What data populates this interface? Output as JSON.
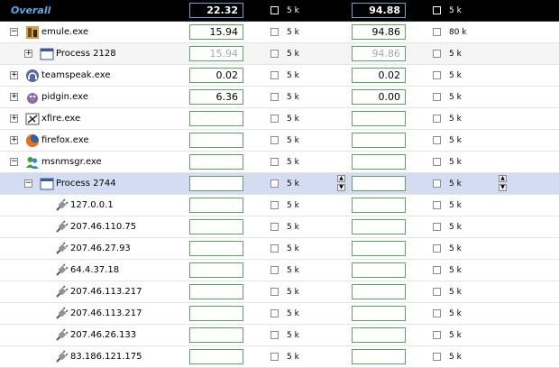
{
  "rows": [
    {
      "id": "overall",
      "label": "Overall",
      "down": "22.32",
      "down_limit": "5 k",
      "up": "94.88",
      "up_limit": "5 k"
    },
    {
      "id": "emule",
      "label": "emule.exe",
      "down": "15.94",
      "down_limit": "5 k",
      "up": "94.86",
      "up_limit": "80 k",
      "expander": "−",
      "icon": "emule-icon"
    },
    {
      "id": "process2128",
      "label": "Process 2128",
      "down": "15.94",
      "down_limit": "5 k",
      "up": "94.86",
      "up_limit": "5 k",
      "expander": "+",
      "icon": "window-icon"
    },
    {
      "id": "teamspeak",
      "label": "teamspeak.exe",
      "down": "0.02",
      "down_limit": "5 k",
      "up": "0.02",
      "up_limit": "5 k",
      "expander": "+",
      "icon": "headset-icon"
    },
    {
      "id": "pidgin",
      "label": "pidgin.exe",
      "down": "6.36",
      "down_limit": "5 k",
      "up": "0.00",
      "up_limit": "5 k",
      "expander": "+",
      "icon": "pidgin-icon"
    },
    {
      "id": "xfire",
      "label": "xfire.exe",
      "down": "",
      "down_limit": "5 k",
      "up": "",
      "up_limit": "5 k",
      "expander": "+",
      "icon": "xfire-icon"
    },
    {
      "id": "firefox",
      "label": "firefox.exe",
      "down": "",
      "down_limit": "5 k",
      "up": "",
      "up_limit": "5 k",
      "expander": "+",
      "icon": "firefox-icon"
    },
    {
      "id": "msnmsgr",
      "label": "msnmsgr.exe",
      "down": "",
      "down_limit": "5 k",
      "up": "",
      "up_limit": "5 k",
      "expander": "−",
      "icon": "msn-icon"
    },
    {
      "id": "process2744",
      "label": "Process 2744",
      "down": "",
      "down_limit": "5 k",
      "up": "",
      "up_limit": "5 k",
      "expander": "−",
      "icon": "window-icon"
    },
    {
      "id": "conn1",
      "label": "127.0.0.1",
      "down": "",
      "down_limit": "5 k",
      "up": "",
      "up_limit": "5 k",
      "icon": "plug-icon"
    },
    {
      "id": "conn2",
      "label": "207.46.110.75",
      "down": "",
      "down_limit": "5 k",
      "up": "",
      "up_limit": "5 k",
      "icon": "plug-icon"
    },
    {
      "id": "conn3",
      "label": "207.46.27.93",
      "down": "",
      "down_limit": "5 k",
      "up": "",
      "up_limit": "5 k",
      "icon": "plug-icon"
    },
    {
      "id": "conn4",
      "label": "64.4.37.18",
      "down": "",
      "down_limit": "5 k",
      "up": "",
      "up_limit": "5 k",
      "icon": "plug-icon"
    },
    {
      "id": "conn5",
      "label": "207.46.113.217",
      "down": "",
      "down_limit": "5 k",
      "up": "",
      "up_limit": "5 k",
      "icon": "plug-icon"
    },
    {
      "id": "conn6",
      "label": "207.46.113.217",
      "down": "",
      "down_limit": "5 k",
      "up": "",
      "up_limit": "5 k",
      "icon": "plug-icon"
    },
    {
      "id": "conn7",
      "label": "207.46.26.133",
      "down": "",
      "down_limit": "5 k",
      "up": "",
      "up_limit": "5 k",
      "icon": "plug-icon"
    },
    {
      "id": "conn8",
      "label": "83.186.121.175",
      "down": "",
      "down_limit": "5 k",
      "up": "",
      "up_limit": "5 k",
      "icon": "plug-icon"
    }
  ],
  "colors": {
    "overall_bg": "#000000",
    "overall_text": "#59a9e8",
    "selected_bg": "#d4dcf2",
    "field_border": "#5fa25f"
  }
}
